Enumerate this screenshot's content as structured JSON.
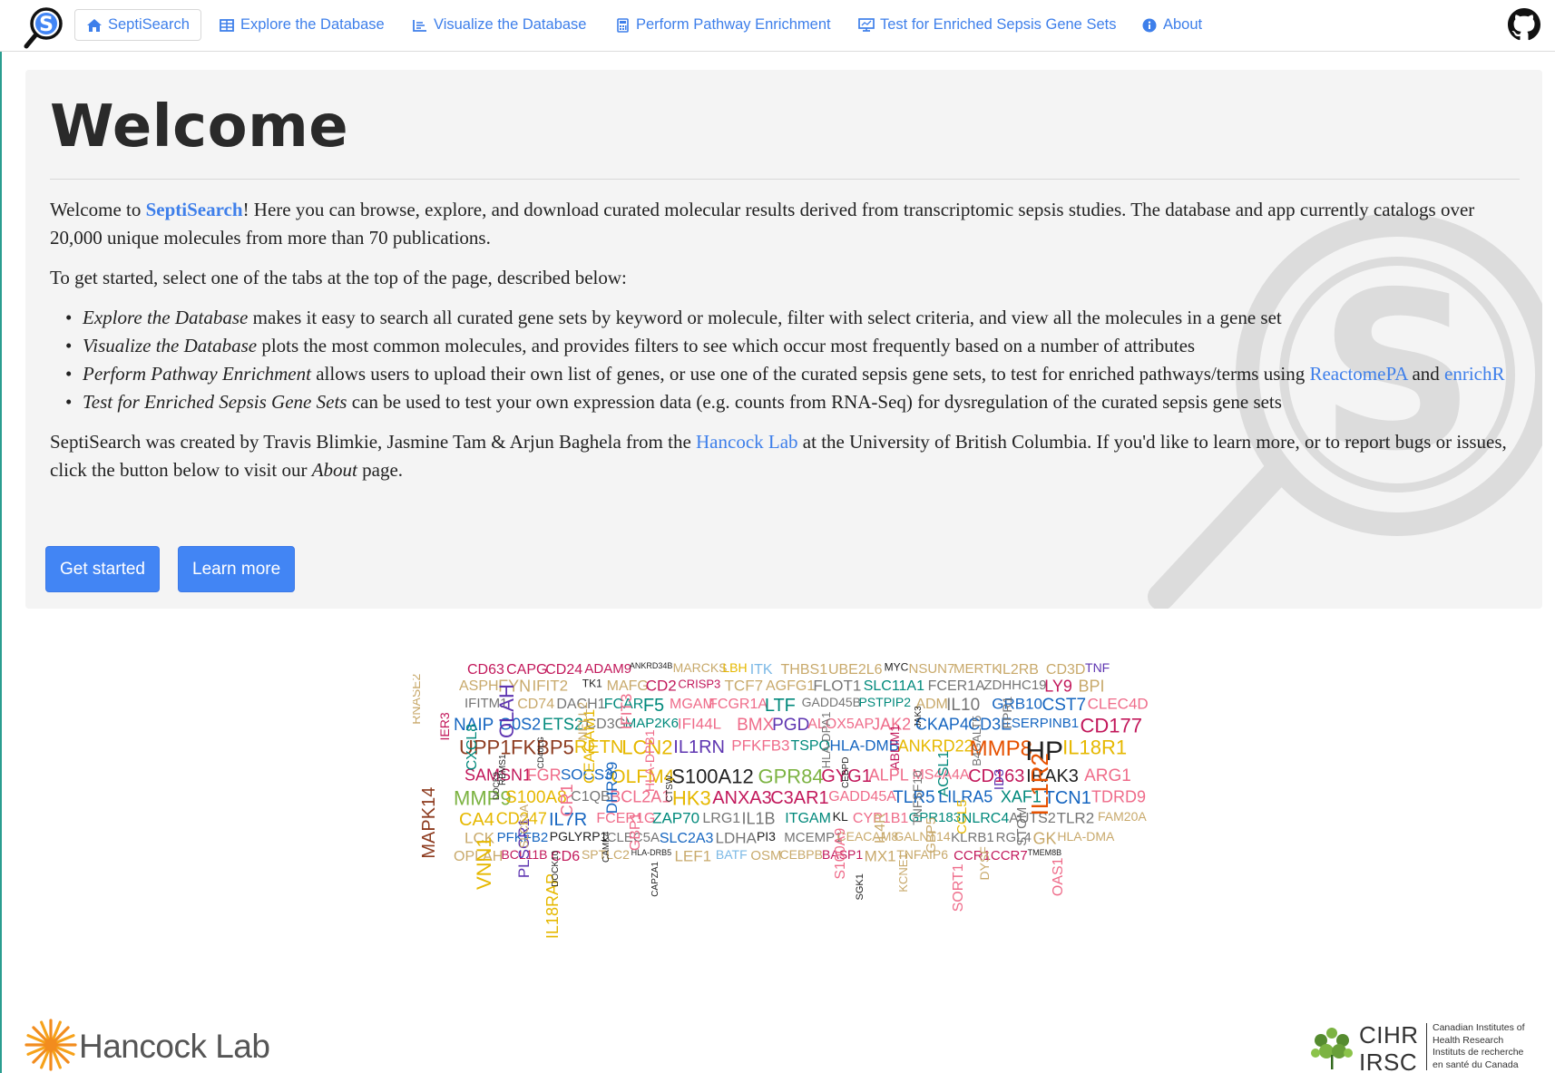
{
  "nav": {
    "brand_icon": "septisearch-logo-icon",
    "items": [
      {
        "label": "SeptiSearch",
        "icon": "home-icon",
        "active": true
      },
      {
        "label": "Explore the Database",
        "icon": "table-icon"
      },
      {
        "label": "Visualize the Database",
        "icon": "chart-icon"
      },
      {
        "label": "Perform Pathway Enrichment",
        "icon": "calculator-icon"
      },
      {
        "label": "Test for Enriched Sepsis Gene Sets",
        "icon": "monitor-icon"
      },
      {
        "label": "About",
        "icon": "info-icon"
      }
    ],
    "github_icon": "github-icon"
  },
  "jumbotron": {
    "title": "Welcome",
    "intro_prefix": "Welcome to ",
    "intro_brand": "SeptiSearch",
    "intro_suffix": "! Here you can browse, explore, and download curated molecular results derived from transcriptomic sepsis studies. The database and app currently catalogs over 20,000 unique molecules from more than 70 publications.",
    "get_started_text": "To get started, select one of the tabs at the top of the page, described below:",
    "bullets": [
      {
        "em": "Explore the Database",
        "text": " makes it easy to search all curated gene sets by keyword or molecule, filter with select criteria, and view all the molecules in a gene set"
      },
      {
        "em": "Visualize the Database",
        "text": " plots the most common molecules, and provides filters to see which occur most frequently based on a number of attributes"
      },
      {
        "em": "Perform Pathway Enrichment",
        "text": " allows users to upload their own list of genes, or use one of the curated sepsis gene sets, to test for enriched pathways/terms using ",
        "link1": "ReactomePA",
        "mid": " and ",
        "link2": "enrichR"
      },
      {
        "em": "Test for Enriched Sepsis Gene Sets",
        "text": " can be used to test your own expression data (e.g. counts from RNA-Seq) for dysregulation of the curated sepsis gene sets"
      }
    ],
    "credits_prefix": "SeptiSearch was created by Travis Blimkie, Jasmine Tam & Arjun Baghela from the ",
    "credits_link": "Hancock Lab",
    "credits_mid": " at the University of British Columbia. If you'd like to learn more, or to report bugs or issues, click the button below to visit our ",
    "credits_em": "About",
    "credits_suffix": " page.",
    "button_get_started": "Get started",
    "button_learn_more": "Learn more",
    "watermark_icon": "septisearch-watermark-icon"
  },
  "wordcloud": {
    "words": [
      {
        "t": "CD63",
        "c": "#c2185b",
        "s": 16
      },
      {
        "t": "CAPG",
        "c": "#c2185b",
        "s": 16
      },
      {
        "t": "CD24",
        "c": "#c2185b",
        "s": 16
      },
      {
        "t": "ADAM9",
        "c": "#c2185b",
        "s": 15
      },
      {
        "t": "ANKRD34B",
        "c": "#222222",
        "s": 9
      },
      {
        "t": "MARCKS",
        "c": "#c8a96b",
        "s": 14
      },
      {
        "t": "LBH",
        "c": "#e6b800",
        "s": 14
      },
      {
        "t": "ITK",
        "c": "#7ab8e6",
        "s": 16
      },
      {
        "t": "THBS1",
        "c": "#c8a96b",
        "s": 16
      },
      {
        "t": "UBE2L6",
        "c": "#c8a96b",
        "s": 16
      },
      {
        "t": "MYC",
        "c": "#222222",
        "s": 12
      },
      {
        "t": "NSUN7",
        "c": "#c8a96b",
        "s": 15
      },
      {
        "t": "MERTK",
        "c": "#c8a96b",
        "s": 15
      },
      {
        "t": "IL2RB",
        "c": "#c8a96b",
        "s": 16
      },
      {
        "t": "CD3D",
        "c": "#c8a96b",
        "s": 16
      },
      {
        "t": "TNF",
        "c": "#5e35b1",
        "s": 14
      },
      {
        "t": "ASPH",
        "c": "#c8a96b",
        "s": 16
      },
      {
        "t": "FYN",
        "c": "#c8a96b",
        "s": 18
      },
      {
        "t": "IFIT2",
        "c": "#c8a96b",
        "s": 17
      },
      {
        "t": "TK1",
        "c": "#222222",
        "s": 12
      },
      {
        "t": "MAFG",
        "c": "#c8a96b",
        "s": 16
      },
      {
        "t": "CD2",
        "c": "#c2185b",
        "s": 17
      },
      {
        "t": "CRISP3",
        "c": "#c2185b",
        "s": 13
      },
      {
        "t": "TCF7",
        "c": "#c8a96b",
        "s": 17
      },
      {
        "t": "AGFG1",
        "c": "#c8a96b",
        "s": 16
      },
      {
        "t": "FLOT1",
        "c": "#757575",
        "s": 17
      },
      {
        "t": "SLC11A1",
        "c": "#00897b",
        "s": 16
      },
      {
        "t": "FCER1A",
        "c": "#757575",
        "s": 16
      },
      {
        "t": "ZDHHC19",
        "c": "#757575",
        "s": 15
      },
      {
        "t": "LY9",
        "c": "#c2185b",
        "s": 18
      },
      {
        "t": "BPI",
        "c": "#c8a96b",
        "s": 18
      },
      {
        "t": "IFITM1",
        "c": "#757575",
        "s": 15
      },
      {
        "t": "CD74",
        "c": "#c8a96b",
        "s": 16
      },
      {
        "t": "DACH1",
        "c": "#757575",
        "s": 16
      },
      {
        "t": "FCAR",
        "c": "#00897b",
        "s": 16
      },
      {
        "t": "F5",
        "c": "#00897b",
        "s": 20
      },
      {
        "t": "MGAM",
        "c": "#ef6c8a",
        "s": 16
      },
      {
        "t": "FCGR1A",
        "c": "#ef6c8a",
        "s": 16
      },
      {
        "t": "LTF",
        "c": "#00897b",
        "s": 20
      },
      {
        "t": "GADD45B",
        "c": "#757575",
        "s": 14
      },
      {
        "t": "PSTPIP2",
        "c": "#00897b",
        "s": 14
      },
      {
        "t": "ADM",
        "c": "#c8a96b",
        "s": 16
      },
      {
        "t": "IL10",
        "c": "#757575",
        "s": 19
      },
      {
        "t": "GRB10",
        "c": "#1565c0",
        "s": 17
      },
      {
        "t": "CST7",
        "c": "#1565c0",
        "s": 19
      },
      {
        "t": "CLEC4D",
        "c": "#ef6c8a",
        "s": 17
      },
      {
        "t": "NAIP",
        "c": "#1565c0",
        "s": 19
      },
      {
        "t": "G0S2",
        "c": "#1565c0",
        "s": 18
      },
      {
        "t": "ETS2",
        "c": "#00897b",
        "s": 18
      },
      {
        "t": "CD3G",
        "c": "#757575",
        "s": 16
      },
      {
        "t": "MAP2K6",
        "c": "#00897b",
        "s": 15
      },
      {
        "t": "IFI44L",
        "c": "#ef6c8a",
        "s": 17
      },
      {
        "t": "BMX",
        "c": "#ef6c8a",
        "s": 19
      },
      {
        "t": "PGD",
        "c": "#5e35b1",
        "s": 19
      },
      {
        "t": "ALOX5AP",
        "c": "#ef6c8a",
        "s": 16
      },
      {
        "t": "JAK2",
        "c": "#ef6c8a",
        "s": 18
      },
      {
        "t": "CKAP4",
        "c": "#1565c0",
        "s": 18
      },
      {
        "t": "CD3E",
        "c": "#1565c0",
        "s": 18
      },
      {
        "t": "SERPINB1",
        "c": "#1565c0",
        "s": 15
      },
      {
        "t": "CD177",
        "c": "#c2185b",
        "s": 22
      },
      {
        "t": "UPP1",
        "c": "#8d3b1f",
        "s": 22
      },
      {
        "t": "FKBP5",
        "c": "#8d3b1f",
        "s": 22
      },
      {
        "t": "RETN",
        "c": "#e6b800",
        "s": 20
      },
      {
        "t": "LCN2",
        "c": "#e6b800",
        "s": 22
      },
      {
        "t": "IL1RN",
        "c": "#5e35b1",
        "s": 20
      },
      {
        "t": "PFKFB3",
        "c": "#ef6c8a",
        "s": 17
      },
      {
        "t": "TSPO",
        "c": "#00897b",
        "s": 16
      },
      {
        "t": "HLA-DMB",
        "c": "#1565c0",
        "s": 17
      },
      {
        "t": "ANKRD22",
        "c": "#e6b800",
        "s": 18
      },
      {
        "t": "MMP8",
        "c": "#e65100",
        "s": 24
      },
      {
        "t": "HP",
        "c": "#222222",
        "s": 30
      },
      {
        "t": "IL18R1",
        "c": "#e6b800",
        "s": 22
      },
      {
        "t": "SAMSN1",
        "c": "#c2185b",
        "s": 18
      },
      {
        "t": "FGR",
        "c": "#ef6c8a",
        "s": 18
      },
      {
        "t": "SOCS3",
        "c": "#1565c0",
        "s": 17
      },
      {
        "t": "OLFM4",
        "c": "#e6b800",
        "s": 21
      },
      {
        "t": "S100A12",
        "c": "#222222",
        "s": 22
      },
      {
        "t": "GPR84",
        "c": "#7cb342",
        "s": 22
      },
      {
        "t": "GYG1",
        "c": "#c2185b",
        "s": 20
      },
      {
        "t": "ALPL",
        "c": "#ef6c8a",
        "s": 18
      },
      {
        "t": "MS4A4A",
        "c": "#ef6c8a",
        "s": 16
      },
      {
        "t": "CD163",
        "c": "#c2185b",
        "s": 20
      },
      {
        "t": "IRAK3",
        "c": "#222222",
        "s": 20
      },
      {
        "t": "ARG1",
        "c": "#ef6c8a",
        "s": 19
      },
      {
        "t": "MMP9",
        "c": "#7cb342",
        "s": 22
      },
      {
        "t": "S100A8",
        "c": "#e6b800",
        "s": 19
      },
      {
        "t": "C1QB",
        "c": "#757575",
        "s": 16
      },
      {
        "t": "BCL2A1",
        "c": "#ef6c8a",
        "s": 18
      },
      {
        "t": "HK3",
        "c": "#e6b800",
        "s": 22
      },
      {
        "t": "ANXA3",
        "c": "#c2185b",
        "s": 20
      },
      {
        "t": "C3AR1",
        "c": "#c2185b",
        "s": 20
      },
      {
        "t": "GADD45A",
        "c": "#ef6c8a",
        "s": 16
      },
      {
        "t": "TLR5",
        "c": "#1565c0",
        "s": 19
      },
      {
        "t": "LILRA5",
        "c": "#1565c0",
        "s": 18
      },
      {
        "t": "XAF1",
        "c": "#00897b",
        "s": 18
      },
      {
        "t": "TCN1",
        "c": "#1565c0",
        "s": 20
      },
      {
        "t": "TDRD9",
        "c": "#ef6c8a",
        "s": 18
      },
      {
        "t": "CA4",
        "c": "#e6b800",
        "s": 20
      },
      {
        "t": "CD247",
        "c": "#e6b800",
        "s": 18
      },
      {
        "t": "IL7R",
        "c": "#1565c0",
        "s": 20
      },
      {
        "t": "FCER1G",
        "c": "#ef6c8a",
        "s": 16
      },
      {
        "t": "ZAP70",
        "c": "#00897b",
        "s": 17
      },
      {
        "t": "LRG1",
        "c": "#757575",
        "s": 16
      },
      {
        "t": "IL1B",
        "c": "#757575",
        "s": 18
      },
      {
        "t": "ITGAM",
        "c": "#00897b",
        "s": 16
      },
      {
        "t": "KL",
        "c": "#222222",
        "s": 14
      },
      {
        "t": "CYP1B1",
        "c": "#ef6c8a",
        "s": 16
      },
      {
        "t": "GPR183",
        "c": "#00897b",
        "s": 15
      },
      {
        "t": "NLRC4",
        "c": "#00897b",
        "s": 16
      },
      {
        "t": "AUTS2",
        "c": "#757575",
        "s": 16
      },
      {
        "t": "TLR2",
        "c": "#757575",
        "s": 17
      },
      {
        "t": "FAM20A",
        "c": "#c8a96b",
        "s": 14
      },
      {
        "t": "LCK",
        "c": "#c8a96b",
        "s": 17
      },
      {
        "t": "PFKFB2",
        "c": "#1565c0",
        "s": 15
      },
      {
        "t": "PGLYRP1",
        "c": "#222222",
        "s": 14
      },
      {
        "t": "CLEC5A",
        "c": "#757575",
        "s": 15
      },
      {
        "t": "SLC2A3",
        "c": "#1565c0",
        "s": 16
      },
      {
        "t": "LDHA",
        "c": "#757575",
        "s": 17
      },
      {
        "t": "PI3",
        "c": "#222222",
        "s": 14
      },
      {
        "t": "MCEMP1",
        "c": "#757575",
        "s": 15
      },
      {
        "t": "CEACAM8",
        "c": "#c8a96b",
        "s": 14
      },
      {
        "t": "GALNT14",
        "c": "#c8a96b",
        "s": 14
      },
      {
        "t": "KLRB1",
        "c": "#757575",
        "s": 15
      },
      {
        "t": "RGL4",
        "c": "#757575",
        "s": 15
      },
      {
        "t": "GK",
        "c": "#c8a96b",
        "s": 18
      },
      {
        "t": "HLA-DMA",
        "c": "#c8a96b",
        "s": 14
      },
      {
        "t": "OPLAH",
        "c": "#c8a96b",
        "s": 16
      },
      {
        "t": "BCL11B",
        "c": "#c2185b",
        "s": 14
      },
      {
        "t": "CD6",
        "c": "#c2185b",
        "s": 16
      },
      {
        "t": "SPTLC2",
        "c": "#c8a96b",
        "s": 14
      },
      {
        "t": "HLA-DRB5",
        "c": "#222222",
        "s": 9
      },
      {
        "t": "LEF1",
        "c": "#c8a96b",
        "s": 17
      },
      {
        "t": "BATF",
        "c": "#7ab8e6",
        "s": 14
      },
      {
        "t": "OSM",
        "c": "#c8a96b",
        "s": 15
      },
      {
        "t": "CEBPB",
        "c": "#c8a96b",
        "s": 14
      },
      {
        "t": "BASP1",
        "c": "#c2185b",
        "s": 14
      },
      {
        "t": "MX1",
        "c": "#c8a96b",
        "s": 17
      },
      {
        "t": "TNFAIP6",
        "c": "#c8a96b",
        "s": 14
      },
      {
        "t": "CCR1",
        "c": "#c2185b",
        "s": 15
      },
      {
        "t": "CCR7",
        "c": "#c2185b",
        "s": 15
      },
      {
        "t": "TMEM8B",
        "c": "#222222",
        "s": 9
      }
    ],
    "vertical_words": [
      {
        "t": "RNASE2",
        "c": "#c8a96b",
        "s": 14
      },
      {
        "t": "CXCL8",
        "c": "#00897b",
        "s": 16
      },
      {
        "t": "DOCK9",
        "c": "#222222",
        "s": 9
      },
      {
        "t": "PLSCR1",
        "c": "#5e35b1",
        "s": 17
      },
      {
        "t": "IL18RAP",
        "c": "#e6b800",
        "s": 18
      },
      {
        "t": "CEACAM1",
        "c": "#e6b800",
        "s": 17
      },
      {
        "t": "DHRS9",
        "c": "#1565c0",
        "s": 17
      },
      {
        "t": "GBP1",
        "c": "#ef6c8a",
        "s": 16
      },
      {
        "t": "CAPZA1",
        "c": "#222222",
        "s": 10
      },
      {
        "t": "HLA-DPA1",
        "c": "#757575",
        "s": 13
      },
      {
        "t": "CEBPD",
        "c": "#222222",
        "s": 10
      },
      {
        "t": "IL4R",
        "c": "#c8a96b",
        "s": 16
      },
      {
        "t": "KCNE1",
        "c": "#c8a96b",
        "s": 13
      },
      {
        "t": "JAK3",
        "c": "#222222",
        "s": 10
      },
      {
        "t": "ACSL1",
        "c": "#00897b",
        "s": 16
      },
      {
        "t": "CCL5",
        "c": "#e6b800",
        "s": 15
      },
      {
        "t": "DYSF",
        "c": "#c8a96b",
        "s": 14
      },
      {
        "t": "FPR1",
        "c": "#757575",
        "s": 14
      },
      {
        "t": "IL1R2",
        "c": "#e65100",
        "s": 26
      },
      {
        "t": "MAPK14",
        "c": "#8d3b1f",
        "s": 20
      },
      {
        "t": "VNN1",
        "c": "#e6b800",
        "s": 22
      },
      {
        "t": "OLAH",
        "c": "#5e35b1",
        "s": 22
      },
      {
        "t": "CD40LG",
        "c": "#222222",
        "s": 9
      },
      {
        "t": "CR1",
        "c": "#ef6c8a",
        "s": 18
      },
      {
        "t": "CAMK4",
        "c": "#222222",
        "s": 10
      },
      {
        "t": "IFIT3",
        "c": "#ef6c8a",
        "s": 17
      },
      {
        "t": "HLA-DPB1",
        "c": "#ef6c8a",
        "s": 14
      },
      {
        "t": "CTSW",
        "c": "#222222",
        "s": 10
      },
      {
        "t": "S100A9",
        "c": "#ef6c8a",
        "s": 16
      },
      {
        "t": "SGK1",
        "c": "#222222",
        "s": 11
      },
      {
        "t": "ABLIM1",
        "c": "#c2185b",
        "s": 14
      },
      {
        "t": "TNFSF10",
        "c": "#757575",
        "s": 14
      },
      {
        "t": "GBP5",
        "c": "#c8a96b",
        "s": 15
      },
      {
        "t": "SORT1",
        "c": "#ef6c8a",
        "s": 16
      },
      {
        "t": "B4GALT5",
        "c": "#757575",
        "s": 13
      },
      {
        "t": "ID3",
        "c": "#5e35b1",
        "s": 15
      },
      {
        "t": "STOM",
        "c": "#757575",
        "s": 15
      },
      {
        "t": "OAS1",
        "c": "#ef6c8a",
        "s": 16
      },
      {
        "t": "IER3",
        "c": "#c2185b",
        "s": 14
      },
      {
        "t": "RBMS1",
        "c": "#222222",
        "s": 10
      },
      {
        "t": "SLC51A",
        "c": "#c8a96b",
        "s": 13
      },
      {
        "t": "DOCK10",
        "c": "#222222",
        "s": 10
      },
      {
        "t": "NELL2",
        "c": "#c8a96b",
        "s": 14
      }
    ]
  },
  "footer": {
    "hancock_label": "Hancock Lab",
    "hancock_icon": "hancock-logo-icon",
    "cihr_acronym_en": "CIHR",
    "cihr_acronym_fr": "IRSC",
    "cihr_line1": "Canadian Institutes of",
    "cihr_line2": "Health Research",
    "cihr_line3": "Instituts de recherche",
    "cihr_line4": "en santé du Canada",
    "cihr_icon": "cihr-maple-leaf-icon"
  },
  "colors": {
    "accent": "#4285f4",
    "link": "#3e7fea",
    "jumbotron_bg": "#f4f4f4"
  }
}
